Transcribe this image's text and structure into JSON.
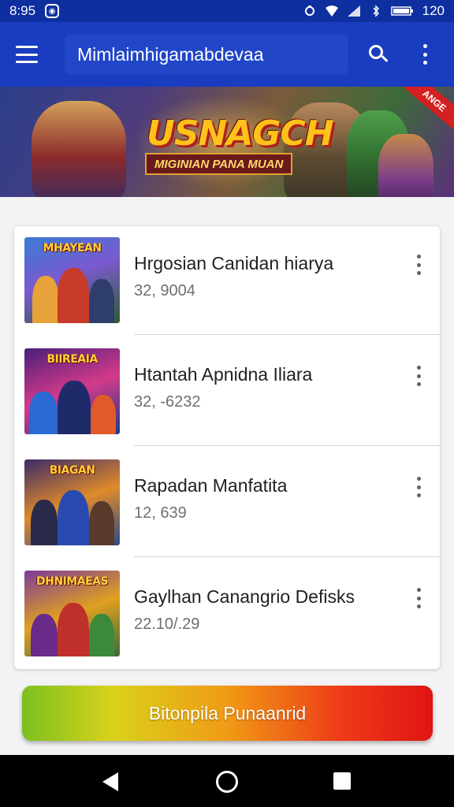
{
  "status_bar": {
    "time": "8:95",
    "battery_level": "120",
    "icons": [
      "notification-icon",
      "sync-icon",
      "wifi-icon",
      "signal-icon",
      "bluetooth-icon",
      "battery-icon"
    ]
  },
  "app_bar": {
    "title": "Mimlaimhigamabdevaa",
    "icons": [
      "menu-icon",
      "search-icon",
      "overflow-menu-icon"
    ]
  },
  "banner": {
    "title": "USNAGCH",
    "subtitle": "MIGINIAN PANA MUAN",
    "ribbon": "ANGE"
  },
  "list": {
    "items": [
      {
        "thumb_title": "MHAYEAN",
        "name": "Hrgosian Canidan hiarya",
        "count": "32, 9004",
        "thumb_colors": [
          "#3a7bd5",
          "#e8a23a",
          "#2e5d2e"
        ]
      },
      {
        "thumb_title": "BIIREAIA",
        "name": "Htantah  Apnidna Iliara",
        "count": "32, -6232",
        "thumb_colors": [
          "#4a1f7a",
          "#d43a8a",
          "#1f3a8a"
        ]
      },
      {
        "thumb_title": "BIAGAN",
        "name": "Rapadan Manfatita",
        "count": "12, 639",
        "thumb_colors": [
          "#3a2a6a",
          "#e08a2a",
          "#2a4a8a"
        ]
      },
      {
        "thumb_title": "DHNIMAEAS",
        "name": "Gaylhan Canangrio Defisks",
        "count": "22.10/.29",
        "thumb_colors": [
          "#7a3a9a",
          "#e0a020",
          "#3a6a3a"
        ]
      }
    ]
  },
  "cta": {
    "label": "Bitonpila Punaanrid"
  },
  "nav_bar": {
    "icons": [
      "back-icon",
      "home-icon",
      "recents-icon"
    ]
  }
}
